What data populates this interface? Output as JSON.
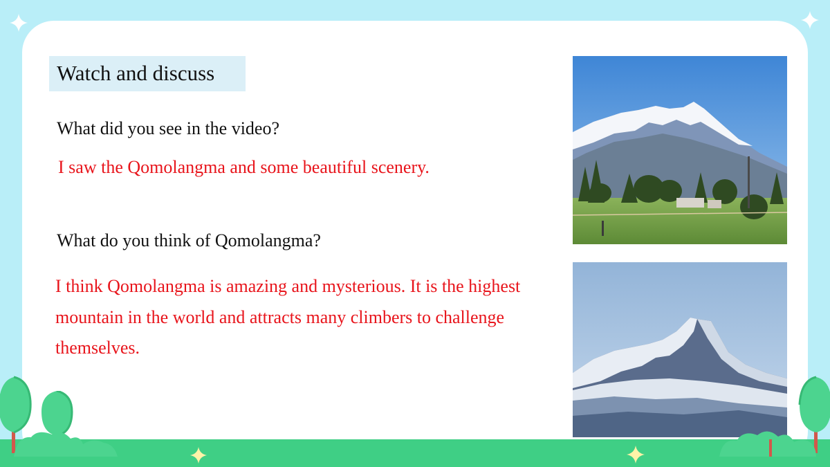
{
  "slide": {
    "title": "Watch and discuss",
    "question1": "What did you see in the video?",
    "answer1": "I saw the Qomolangma and some beautiful scenery.",
    "question2": "What do you think of Qomolangma?",
    "answer2": "I think Qomolangma is amazing and mysterious. It is the highest mountain in the world and attracts many climbers to challenge themselves."
  },
  "colors": {
    "background": "#b9eef8",
    "card": "#ffffff",
    "title_highlight": "#dbeff7",
    "answer_text": "#e8141b",
    "ground": "#3fcf85",
    "tree": "#4cd48f"
  },
  "images": [
    {
      "name": "snowy-mountain-valley-photo"
    },
    {
      "name": "qomolangma-peak-photo"
    }
  ]
}
